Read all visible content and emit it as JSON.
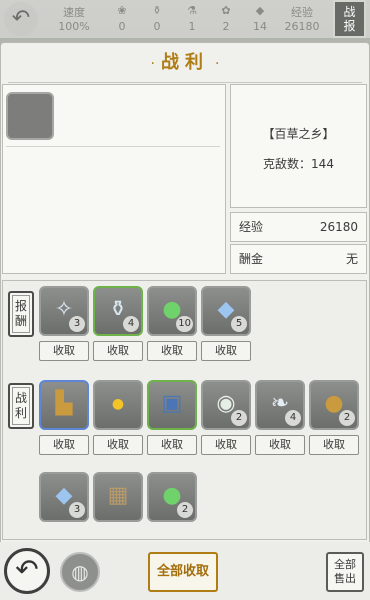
{
  "status_bar": {
    "items": [
      {
        "label": "速度",
        "value": "100%"
      },
      {
        "label": "",
        "value": "0"
      },
      {
        "label": "",
        "value": "0"
      },
      {
        "label": "",
        "value": "1"
      },
      {
        "label": "",
        "value": "2"
      },
      {
        "label": "",
        "value": "14"
      },
      {
        "label": "经验",
        "value": "26180"
      }
    ],
    "report_tab": "战报"
  },
  "panel": {
    "title": "战利",
    "location": "【百草之乡】",
    "defeat_count": "克敌数：144",
    "exp_label": "经验",
    "exp_value": "26180",
    "reward_label": "酬金",
    "reward_value": "无"
  },
  "sections": {
    "reward_tag": "报酬",
    "loot_tag": "战利"
  },
  "reward_items": [
    {
      "icon": "feather-icon",
      "glyph": "✧",
      "count": "3",
      "rarity": "gray"
    },
    {
      "icon": "jar-icon",
      "glyph": "🫖",
      "count": "4",
      "rarity": "green"
    },
    {
      "icon": "green-potion-icon",
      "glyph": "🟢",
      "count": "10",
      "rarity": "gray"
    },
    {
      "icon": "gourd-icon",
      "glyph": "◆",
      "count": "5",
      "rarity": "gray"
    }
  ],
  "loot_items": [
    {
      "icon": "boots-icon",
      "glyph": "👢",
      "count": "",
      "rarity": "blue"
    },
    {
      "icon": "gold-orb-icon",
      "glyph": "●",
      "count": "",
      "rarity": "gray"
    },
    {
      "icon": "chest-icon",
      "glyph": "▣",
      "count": "",
      "rarity": "green"
    },
    {
      "icon": "pot-icon",
      "glyph": "◉",
      "count": "2",
      "rarity": "gray"
    },
    {
      "icon": "leaf-icon",
      "glyph": "❧",
      "count": "4",
      "rarity": "gray"
    },
    {
      "icon": "money-bag-icon",
      "glyph": "💰",
      "count": "2",
      "rarity": "gray"
    },
    {
      "icon": "gourd-icon",
      "glyph": "◆",
      "count": "3",
      "rarity": "gray"
    },
    {
      "icon": "crate-icon",
      "glyph": "▦",
      "count": "",
      "rarity": "gray"
    },
    {
      "icon": "green-potion-icon",
      "glyph": "🟢",
      "count": "2",
      "rarity": "gray"
    }
  ],
  "collect_label": "收取",
  "bottom": {
    "collect_all": "全部收取",
    "sell_all": "全部售出"
  },
  "colors": {
    "accent": "#b07d15",
    "rare_green": "#6db34a",
    "rare_blue": "#5d86d6"
  }
}
